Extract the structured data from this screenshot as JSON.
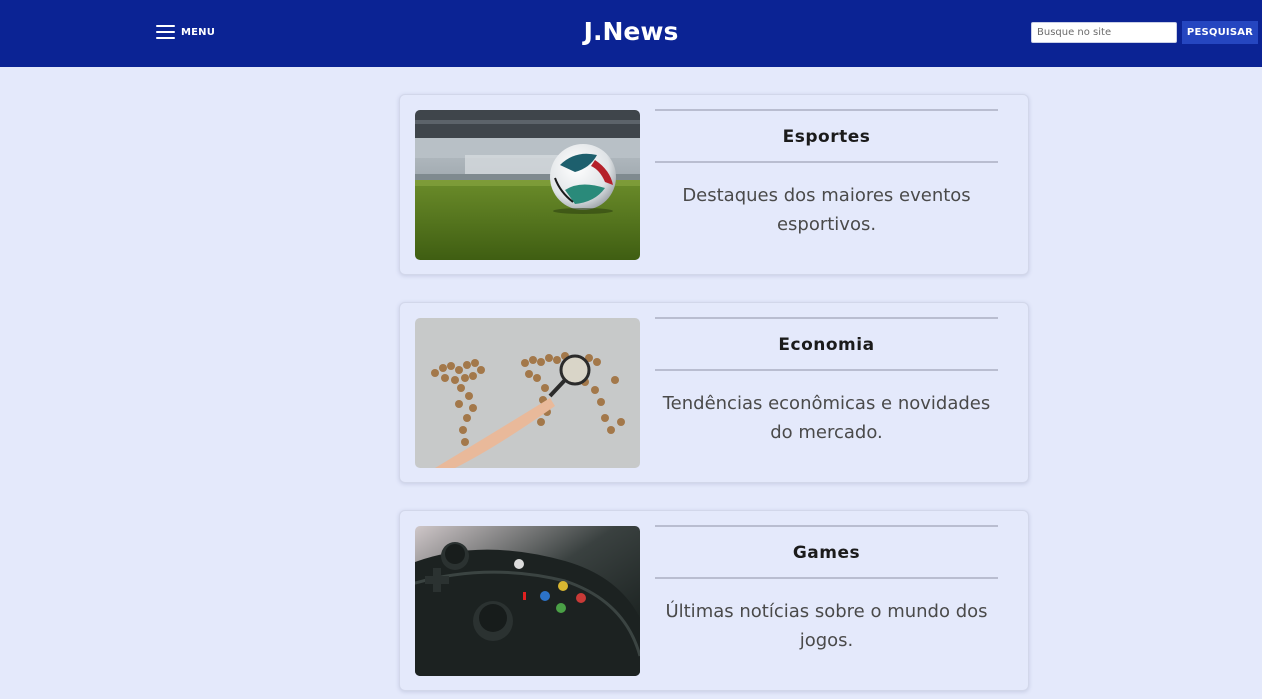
{
  "header": {
    "menu_label": "MENU",
    "brand": "J.News",
    "search_placeholder": "Busque no site",
    "search_button": "PESQUISAR"
  },
  "cards": [
    {
      "title": "Esportes",
      "description": "Destaques dos maiores eventos esportivos.",
      "image": "soccer-ball-photo"
    },
    {
      "title": "Economia",
      "description": "Tendências econômicas e novidades do mercado.",
      "image": "coin-world-map-photo"
    },
    {
      "title": "Games",
      "description": "Últimas notícias sobre o mundo dos jogos.",
      "image": "game-controller-photo"
    }
  ],
  "colors": {
    "header_bg": "#0b2394",
    "page_bg": "#e4e9fb",
    "button_bg": "#2546c0"
  }
}
